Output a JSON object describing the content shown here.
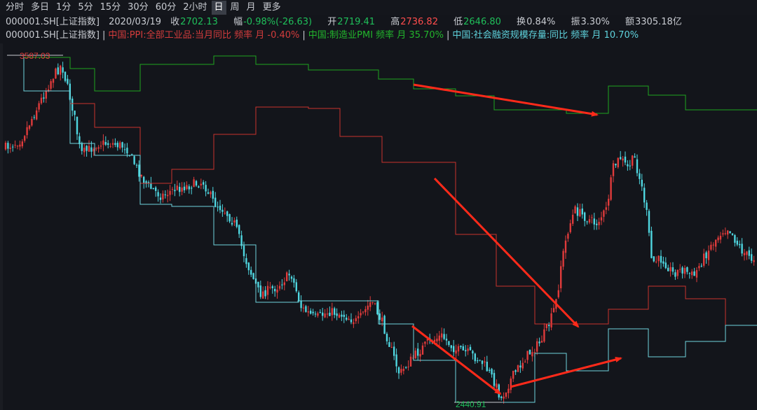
{
  "toolbar": {
    "periods": [
      "分时",
      "多日",
      "1分",
      "5分",
      "15分",
      "30分",
      "60分",
      "2小时",
      "日",
      "周",
      "月",
      "更多"
    ],
    "active": "日"
  },
  "info": {
    "symbol": "000001.SH[上证指数]",
    "date": "2020/03/19",
    "close_label": "收",
    "close": "2702.13",
    "change_label": "幅",
    "change": "-0.98%(-26.63)",
    "open_label": "开",
    "open": "2719.41",
    "high_label": "高",
    "high": "2736.82",
    "low_label": "低",
    "low": "2646.80",
    "turnover_label": "换",
    "turnover": "0.84%",
    "amplitude_label": "振",
    "amplitude": "3.30%",
    "amount_label": "额",
    "amount": "3305.18亿"
  },
  "legend": {
    "symbol": "000001.SH[上证指数]",
    "ppi": "中国:PPI:全部工业品:当月同比 频率 月 -0.40%",
    "pmi": "中国:制造业PMI 频率 月 35.70%",
    "tsf": "中国:社会融资规模存量:同比 频率 月 10.70%"
  },
  "colors": {
    "up": "#e03b3b",
    "down": "#4fd6e0",
    "ppi": "#c8322e",
    "pmi": "#1fa51f",
    "tsf": "#6fd4dc",
    "arrow": "#ff2a1a",
    "bg": "#13151b"
  },
  "chart_data": {
    "type": "candlestick",
    "annotations": {
      "high_label": "3587.03",
      "low_label": "2440.91"
    },
    "overlay_series": [
      "PPI YoY",
      "Manufacturing PMI",
      "Social financing stock YoY"
    ]
  }
}
